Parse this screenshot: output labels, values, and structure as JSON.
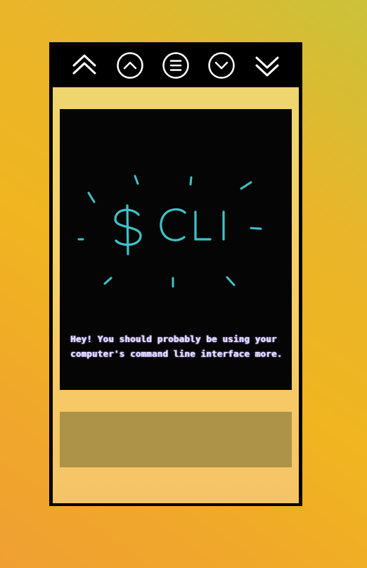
{
  "toolbar": {
    "buttons": [
      {
        "name": "first-button",
        "icon": "double-chevron-up-icon"
      },
      {
        "name": "previous-button",
        "icon": "circle-chevron-up-icon"
      },
      {
        "name": "menu-button",
        "icon": "circle-menu-icon"
      },
      {
        "name": "next-button",
        "icon": "circle-chevron-down-icon"
      },
      {
        "name": "last-button",
        "icon": "double-chevron-down-icon"
      }
    ],
    "icon_color": "#ffffff"
  },
  "card": {
    "art_text": "$CLI",
    "art_color": "#3fc3c8",
    "message": "Hey! You should probably be using your computer's command line interface more."
  },
  "colors": {
    "card_background": "#050505",
    "panel_background": "#ad9347",
    "text_color": "#e8e4f6"
  }
}
